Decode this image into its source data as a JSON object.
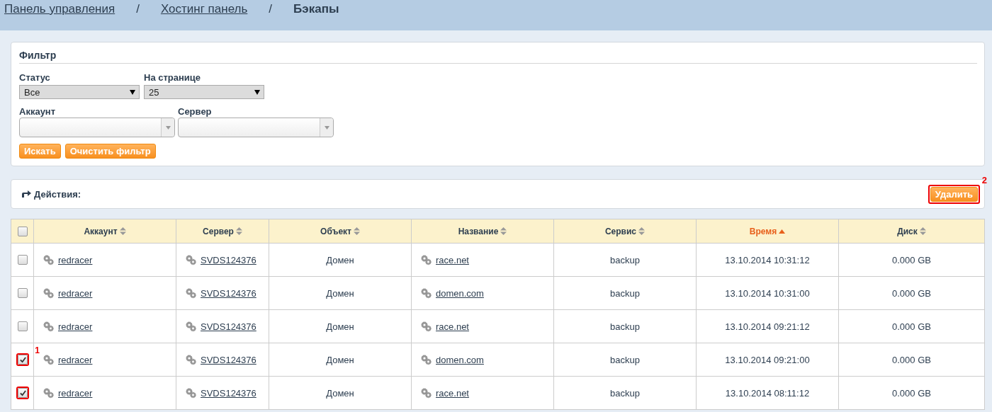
{
  "breadcrumbs": [
    {
      "label": "Панель управления",
      "kind": "link"
    },
    {
      "label": "Хостинг панель",
      "kind": "link"
    },
    {
      "label": "Бэкапы",
      "kind": "current"
    }
  ],
  "breadcrumb_separator": "/",
  "filter": {
    "title": "Фильтр",
    "selects": [
      {
        "label": "Статус",
        "value": "Все"
      },
      {
        "label": "На странице",
        "value": "25"
      }
    ],
    "combos": [
      {
        "label": "Аккаунт"
      },
      {
        "label": "Сервер"
      }
    ],
    "buttons": [
      "Искать",
      "Очистить фильтр"
    ]
  },
  "actions": {
    "label": "Действия:",
    "button": {
      "label": "Удалить",
      "highlighted": true,
      "annotation": "2"
    }
  },
  "table": {
    "select_all": {
      "checked": false
    },
    "columns": [
      {
        "label": "Аккаунт",
        "sorted": false
      },
      {
        "label": "Сервер",
        "sorted": false
      },
      {
        "label": "Объект",
        "sorted": false
      },
      {
        "label": "Название",
        "sorted": false
      },
      {
        "label": "Сервис",
        "sorted": false
      },
      {
        "label": "Время",
        "sorted": true
      },
      {
        "label": "Диск",
        "sorted": false
      }
    ],
    "rows": [
      {
        "checked": false,
        "highlighted": false,
        "account": "redracer",
        "server": "SVDS124376",
        "object": "Домен",
        "name": "race.net",
        "service": "backup",
        "time": "13.10.2014 10:31:12",
        "disk": "0.000 GB"
      },
      {
        "checked": false,
        "highlighted": false,
        "account": "redracer",
        "server": "SVDS124376",
        "object": "Домен",
        "name": "domen.com",
        "service": "backup",
        "time": "13.10.2014 10:31:00",
        "disk": "0.000 GB"
      },
      {
        "checked": false,
        "highlighted": false,
        "account": "redracer",
        "server": "SVDS124376",
        "object": "Домен",
        "name": "race.net",
        "service": "backup",
        "time": "13.10.2014 09:21:12",
        "disk": "0.000 GB"
      },
      {
        "checked": true,
        "highlighted": true,
        "annotation": "1",
        "account": "redracer",
        "server": "SVDS124376",
        "object": "Домен",
        "name": "domen.com",
        "service": "backup",
        "time": "13.10.2014 09:21:00",
        "disk": "0.000 GB"
      },
      {
        "checked": true,
        "highlighted": true,
        "account": "redracer",
        "server": "SVDS124376",
        "object": "Домен",
        "name": "race.net",
        "service": "backup",
        "time": "13.10.2014 08:11:12",
        "disk": "0.000 GB"
      }
    ]
  }
}
